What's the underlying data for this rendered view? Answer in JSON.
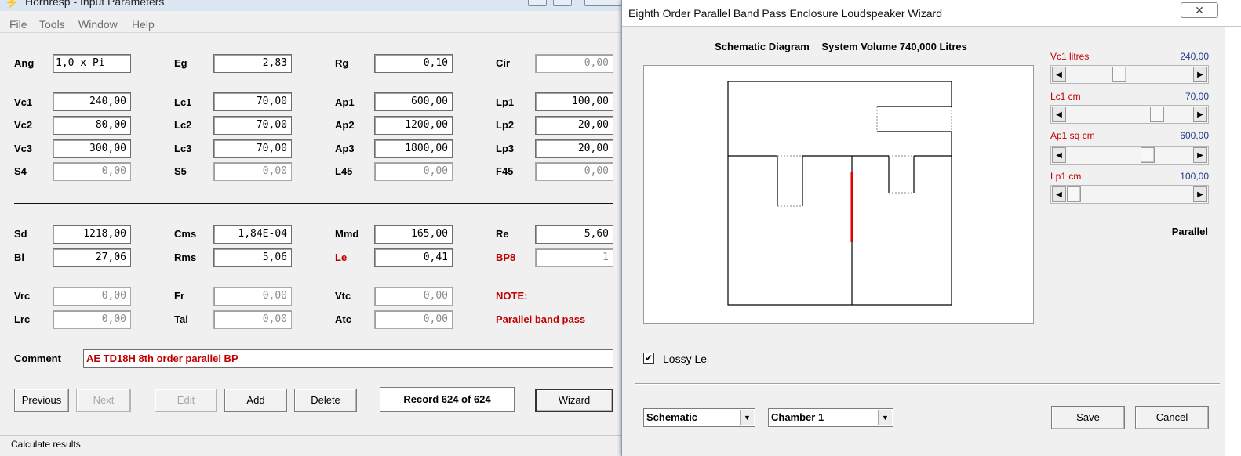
{
  "main_window": {
    "title": "Hornresp - Input Parameters",
    "menu": [
      "File",
      "Tools",
      "Window",
      "Help"
    ]
  },
  "params": {
    "ang": {
      "label": "Ang",
      "value": "1,0 x Pi"
    },
    "eg": {
      "label": "Eg",
      "value": "2,83"
    },
    "rg": {
      "label": "Rg",
      "value": "0,10"
    },
    "cir": {
      "label": "Cir",
      "value": "0,00"
    },
    "vc1": {
      "label": "Vc1",
      "value": "240,00"
    },
    "lc1": {
      "label": "Lc1",
      "value": "70,00"
    },
    "ap1": {
      "label": "Ap1",
      "value": "600,00"
    },
    "lp1": {
      "label": "Lp1",
      "value": "100,00"
    },
    "vc2": {
      "label": "Vc2",
      "value": "80,00"
    },
    "lc2": {
      "label": "Lc2",
      "value": "70,00"
    },
    "ap2": {
      "label": "Ap2",
      "value": "1200,00"
    },
    "lp2": {
      "label": "Lp2",
      "value": "20,00"
    },
    "vc3": {
      "label": "Vc3",
      "value": "300,00"
    },
    "lc3": {
      "label": "Lc3",
      "value": "70,00"
    },
    "ap3": {
      "label": "Ap3",
      "value": "1800,00"
    },
    "lp3": {
      "label": "Lp3",
      "value": "20,00"
    },
    "s4": {
      "label": "S4",
      "value": "0,00"
    },
    "s5": {
      "label": "S5",
      "value": "0,00"
    },
    "l45": {
      "label": "L45",
      "value": "0,00"
    },
    "f45": {
      "label": "F45",
      "value": "0,00"
    },
    "sd": {
      "label": "Sd",
      "value": "1218,00"
    },
    "cms": {
      "label": "Cms",
      "value": "1,84E-04"
    },
    "mmd": {
      "label": "Mmd",
      "value": "165,00"
    },
    "re": {
      "label": "Re",
      "value": "5,60"
    },
    "bl": {
      "label": "Bl",
      "value": "27,06"
    },
    "rms": {
      "label": "Rms",
      "value": "5,06"
    },
    "le": {
      "label": "Le",
      "value": "0,41"
    },
    "bp8": {
      "label": "BP8",
      "value": "1"
    },
    "vrc": {
      "label": "Vrc",
      "value": "0,00"
    },
    "fr": {
      "label": "Fr",
      "value": "0,00"
    },
    "vtc": {
      "label": "Vtc",
      "value": "0,00"
    },
    "lrc": {
      "label": "Lrc",
      "value": "0,00"
    },
    "tal": {
      "label": "Tal",
      "value": "0,00"
    },
    "atc": {
      "label": "Atc",
      "value": "0,00"
    }
  },
  "note": {
    "label": "NOTE:",
    "text": "Parallel band pass"
  },
  "comment": {
    "label": "Comment",
    "value": "AE TD18H 8th order parallel BP"
  },
  "buttons": {
    "previous": "Previous",
    "next": "Next",
    "edit": "Edit",
    "add": "Add",
    "delete": "Delete",
    "wizard": "Wizard"
  },
  "record": "Record 624 of 624",
  "status": "Calculate results",
  "wizard": {
    "title": "Eighth Order Parallel Band Pass Enclosure Loudspeaker Wizard",
    "close_glyph": "✕",
    "diagram_title": "Schematic Diagram",
    "system_volume": "System Volume 740,000 Litres",
    "sliders": [
      {
        "label": "Vc1  litres",
        "value": "240,00"
      },
      {
        "label": "Lc1  cm",
        "value": "70,00"
      },
      {
        "label": "Ap1  sq cm",
        "value": "600,00"
      },
      {
        "label": "Lp1  cm",
        "value": "100,00"
      }
    ],
    "mode": "Parallel",
    "lossy_le": {
      "label": "Lossy Le",
      "checked": true,
      "mark": "✔"
    },
    "view_select": "Schematic",
    "chamber_select": "Chamber 1",
    "save": "Save",
    "cancel": "Cancel"
  },
  "colors": {
    "accent_red": "#c00000",
    "value_blue": "#1f3c88",
    "driver_red": "#e00000"
  },
  "icons": {
    "left_arrow": "◀",
    "right_arrow": "▶",
    "dropdown": "▼"
  }
}
